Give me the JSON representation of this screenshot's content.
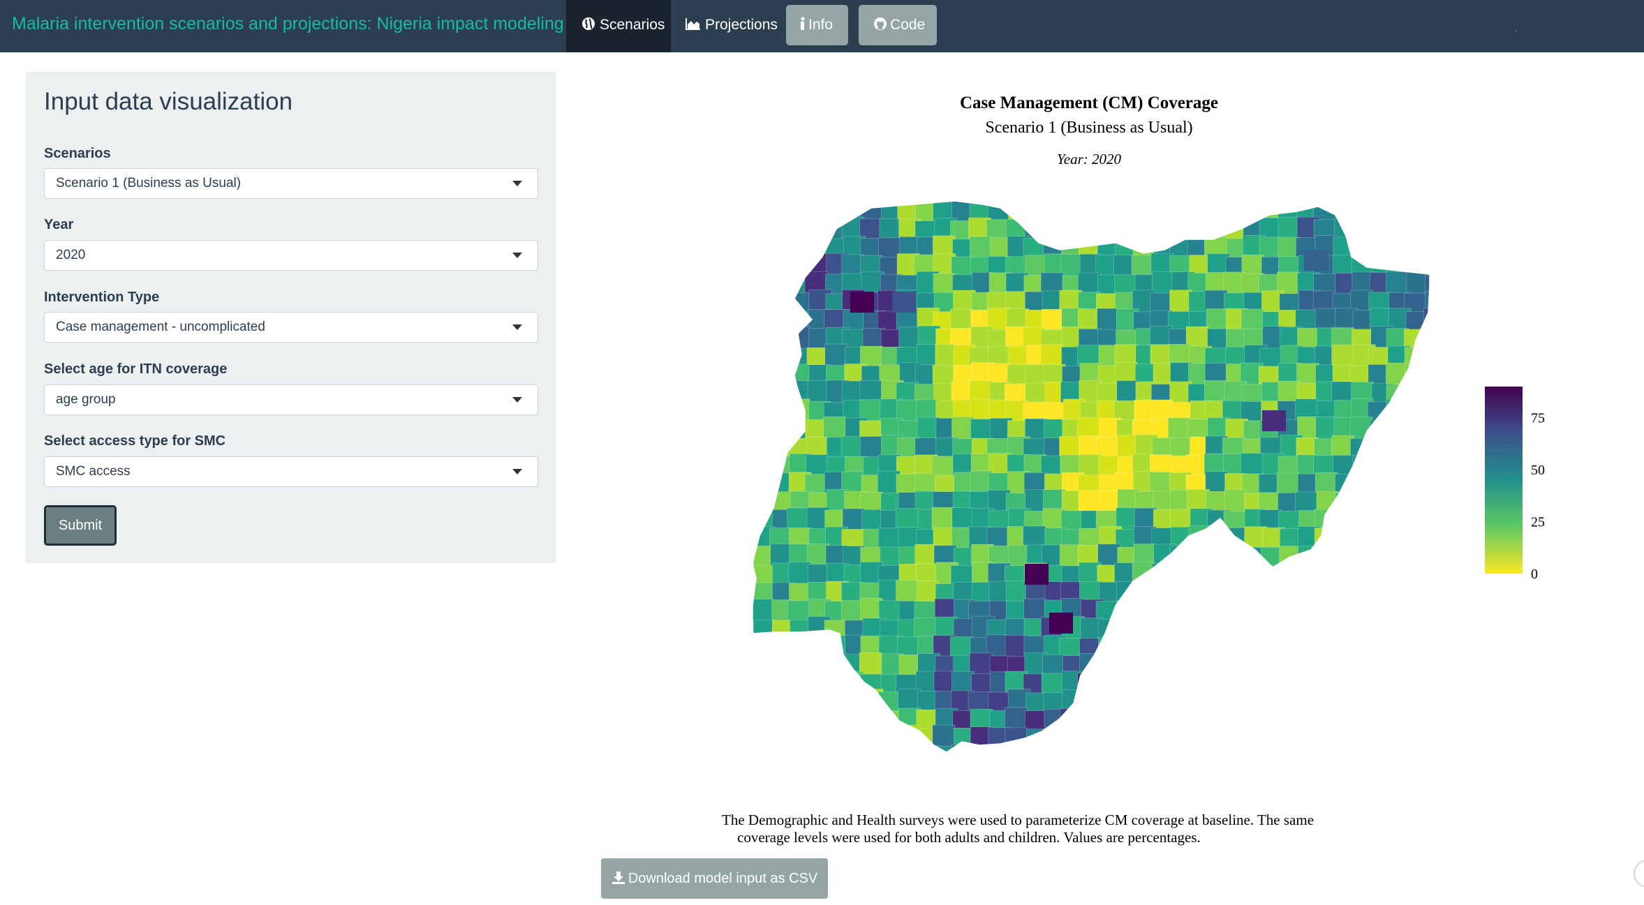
{
  "navbar": {
    "brand": "Malaria intervention scenarios and projections: Nigeria impact modeling",
    "tabs": [
      {
        "label": "Scenarios",
        "icon": "globe-icon",
        "active": true
      },
      {
        "label": "Projections",
        "icon": "area-chart-icon",
        "active": false
      }
    ],
    "buttons": [
      {
        "label": "Info",
        "icon": "info-icon"
      },
      {
        "label": "Code",
        "icon": "github-icon"
      }
    ],
    "colors": {
      "navbar_bg": "#2c3e50",
      "brand": "#18bc9c",
      "active_tab_bg": "#1a242f",
      "button_bg": "#95a5a6"
    }
  },
  "sidebar": {
    "title": "Input data visualization",
    "fields": [
      {
        "label": "Scenarios",
        "value": "Scenario 1 (Business as Usual)"
      },
      {
        "label": "Year",
        "value": "2020"
      },
      {
        "label": "Intervention Type",
        "value": "Case management - uncomplicated"
      },
      {
        "label": "Select age for ITN coverage",
        "value": "age group"
      },
      {
        "label": "Select access type for SMC",
        "value": "SMC access"
      }
    ],
    "submit_label": "Submit"
  },
  "map": {
    "title": "Case Management (CM) Coverage",
    "subtitle": "Scenario 1 (Business as Usual)",
    "year_label": "Year: 2020",
    "legend": {
      "ticks": [
        "75",
        "50",
        "25",
        "0"
      ],
      "tick_values": [
        75,
        50,
        25,
        0
      ],
      "min": 0,
      "max": 90,
      "colorscale": [
        "#fde725",
        "#5ec962",
        "#21918c",
        "#3b528b",
        "#440154"
      ]
    },
    "caption_line1": "The Demographic and Health surveys were used to parameterize CM coverage at baseline. The same",
    "caption_line2": "coverage levels were used for both adults and children. Values are percentages.",
    "download_label": "Download model input as CSV"
  }
}
